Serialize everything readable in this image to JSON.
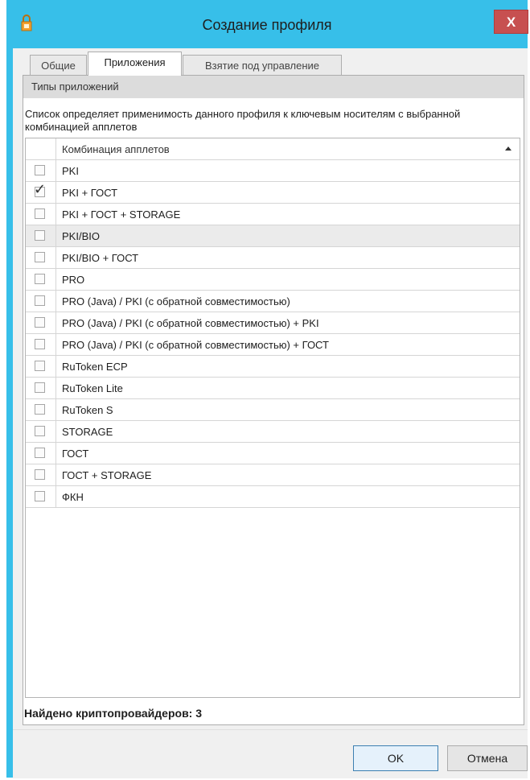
{
  "window": {
    "title": "Создание профиля",
    "close_glyph": "X",
    "app_icon": "app-shield-icon",
    "frame_color": "#37bfe9"
  },
  "tabs": [
    {
      "label": "Общие",
      "active": false
    },
    {
      "label": "Приложения",
      "active": true
    },
    {
      "label": "Взятие под управление",
      "active": false
    }
  ],
  "section": {
    "header": "Типы приложений",
    "description": "Список определяет применимость данного профиля к ключевым носителям с выбранной комбинацией апплетов"
  },
  "grid": {
    "column_header": "Комбинация апплетов",
    "sort_icon": "sort-ascending-icon",
    "rows": [
      {
        "label": "PKI",
        "checked": false
      },
      {
        "label": "PKI + ГОСТ",
        "checked": true
      },
      {
        "label": "PKI + ГОСТ + STORAGE",
        "checked": false
      },
      {
        "label": "PKI/BIO",
        "checked": false,
        "selected": true
      },
      {
        "label": "PKI/BIO + ГОСТ",
        "checked": false
      },
      {
        "label": "PRO",
        "checked": false
      },
      {
        "label": "PRO (Java) / PKI (с обратной совместимостью)",
        "checked": false
      },
      {
        "label": "PRO (Java) / PKI (с обратной совместимостью) + PKI",
        "checked": false
      },
      {
        "label": "PRO (Java) / PKI (с обратной совместимостью) + ГОСТ",
        "checked": false
      },
      {
        "label": "RuToken ECP",
        "checked": false
      },
      {
        "label": "RuToken Lite",
        "checked": false
      },
      {
        "label": "RuToken S",
        "checked": false
      },
      {
        "label": "STORAGE",
        "checked": false
      },
      {
        "label": "ГОСТ",
        "checked": false
      },
      {
        "label": "ГОСТ + STORAGE",
        "checked": false
      },
      {
        "label": "ФКН",
        "checked": false
      }
    ]
  },
  "status": "Найдено криптопровайдеров: 3",
  "buttons": {
    "ok": "OK",
    "cancel": "Отмена"
  }
}
